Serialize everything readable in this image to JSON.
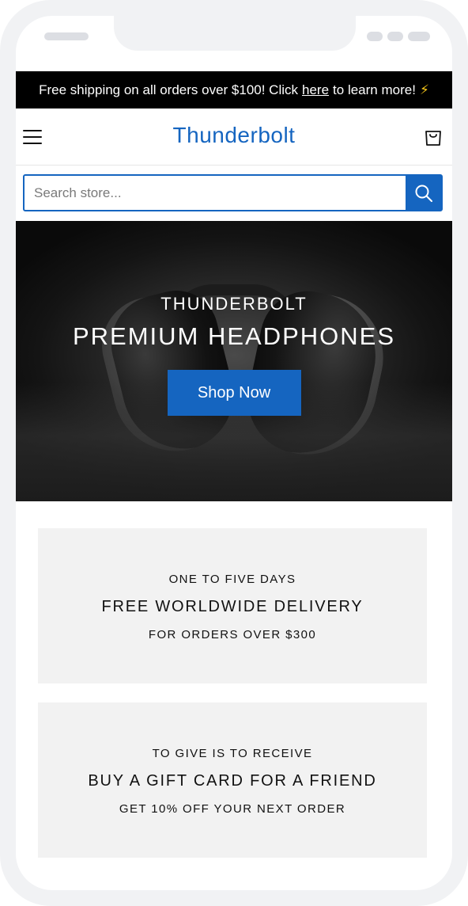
{
  "announcement": {
    "prefix": "Free shipping on all orders over $100! Click",
    "link": "here",
    "suffix": "to learn more!",
    "icon": "lightning-bolt-icon"
  },
  "header": {
    "logo": "Thunderbolt",
    "menu_icon": "hamburger-menu-icon",
    "cart_icon": "shopping-bag-icon"
  },
  "search": {
    "placeholder": "Search store...",
    "value": "",
    "button_icon": "search-icon"
  },
  "hero": {
    "brand": "THUNDERBOLT",
    "title": "PREMIUM HEADPHONES",
    "cta": "Shop Now"
  },
  "promos": [
    {
      "kicker": "ONE TO FIVE DAYS",
      "headline": "FREE WORLDWIDE DELIVERY",
      "sub": "FOR ORDERS OVER $300"
    },
    {
      "kicker": "TO GIVE IS TO RECEIVE",
      "headline": "BUY A GIFT CARD FOR A FRIEND",
      "sub": "GET 10% OFF YOUR NEXT ORDER"
    }
  ],
  "colors": {
    "accent": "#1565c0",
    "announcement_bg": "#000000",
    "promo_bg": "#f2f2f2",
    "bolt": "#f5c518"
  }
}
